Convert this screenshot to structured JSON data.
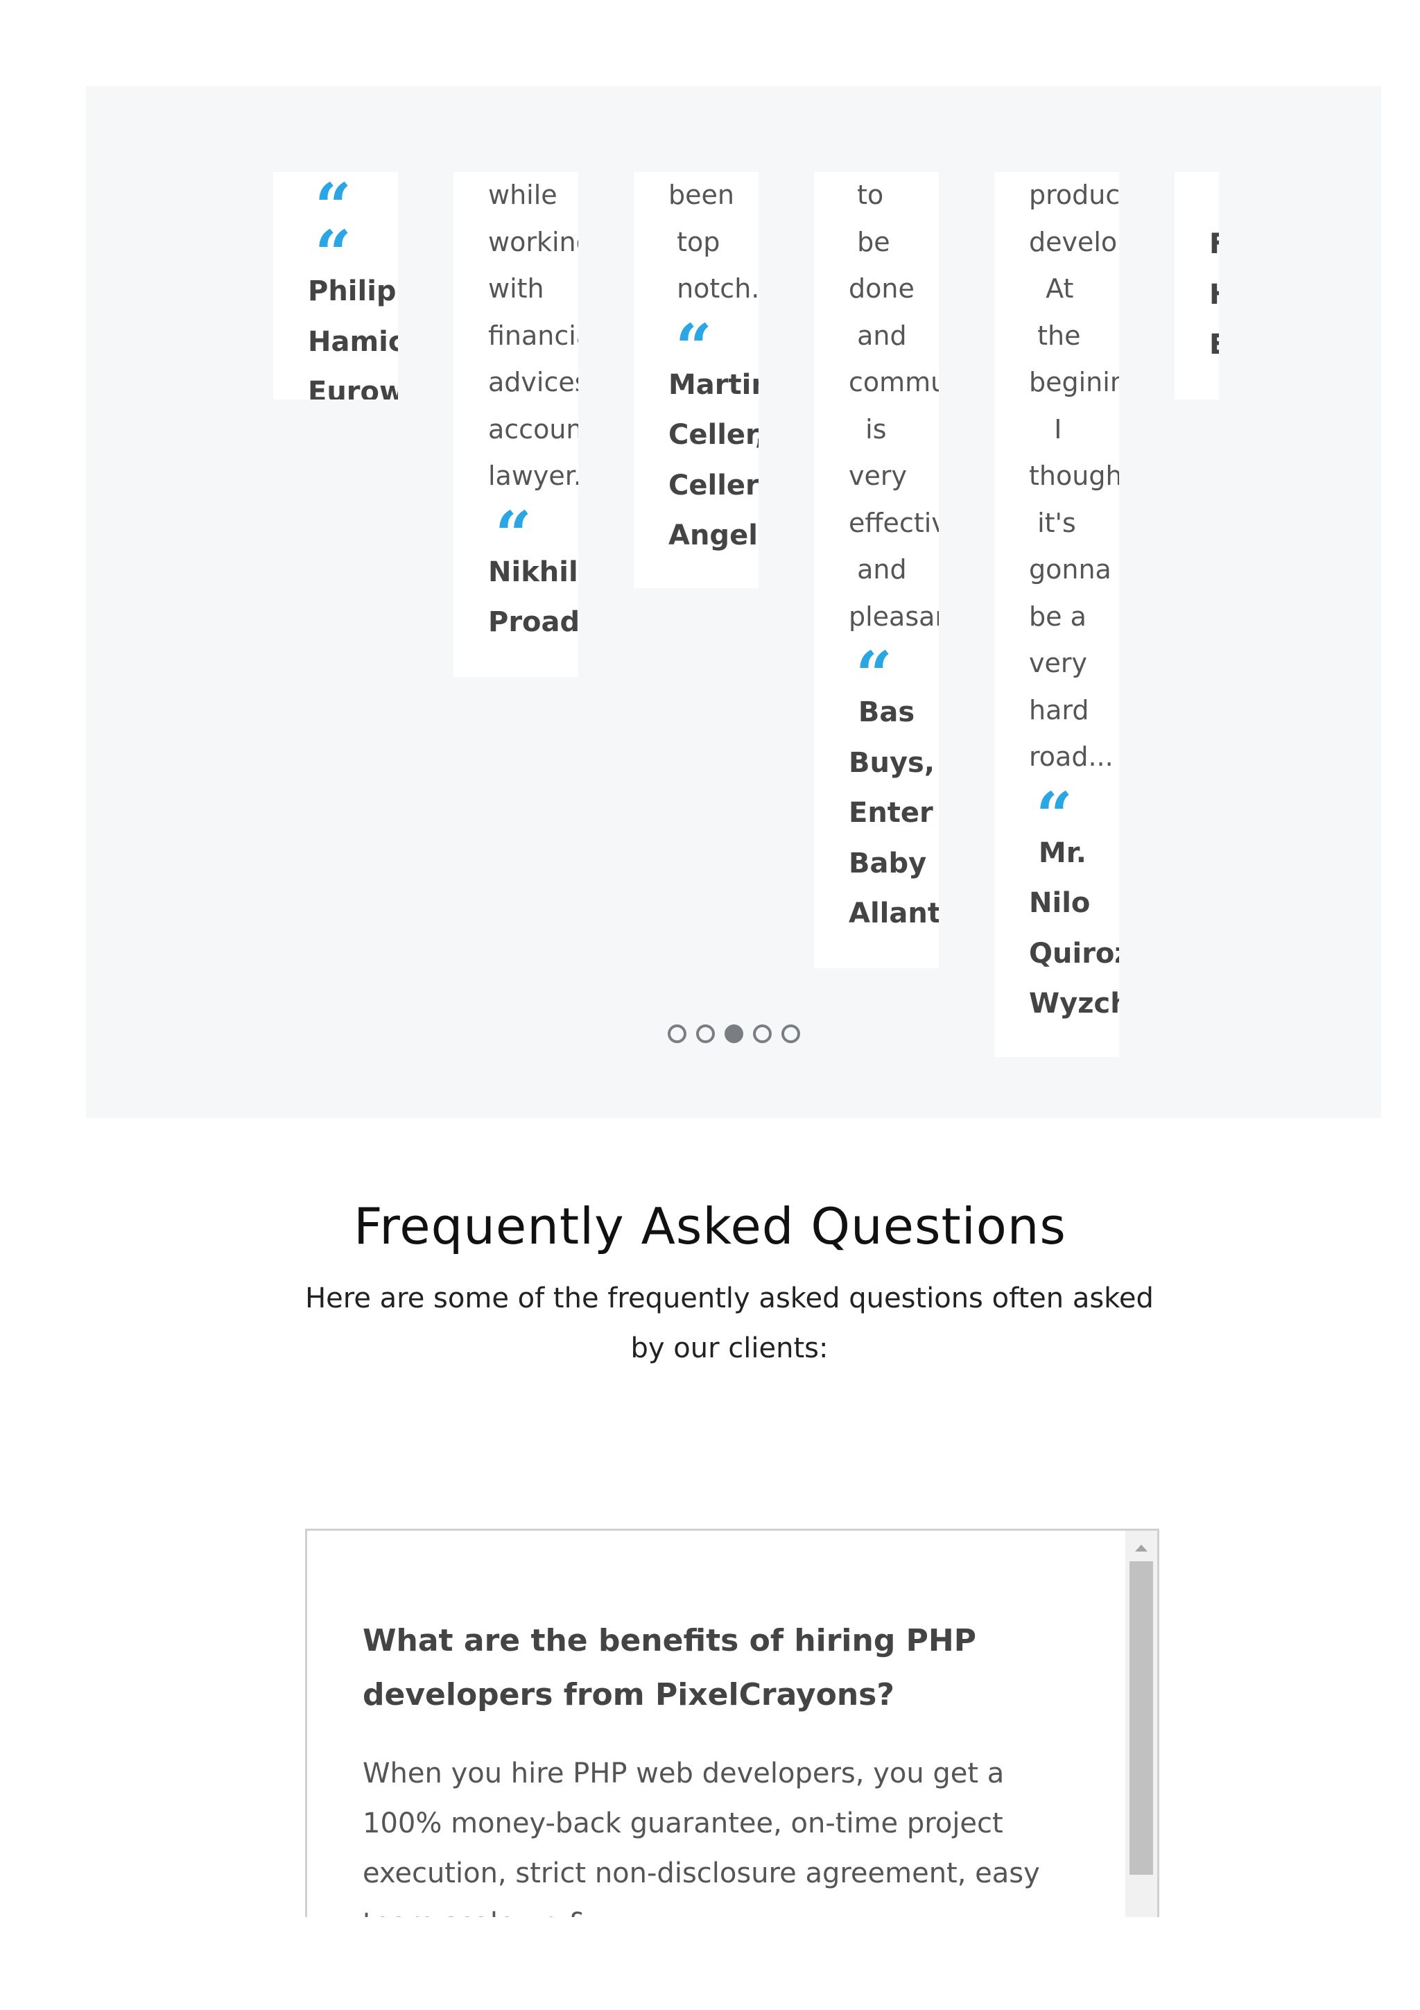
{
  "testimonials": [
    {
      "lines": [],
      "author": [
        "Philip",
        "Hamich",
        "Eurowi"
      ]
    },
    {
      "lines": [
        "while",
        "working",
        "with",
        "financia",
        "advices",
        "accoun",
        "lawyer."
      ],
      "author": [
        "Nikhil,",
        "Proadv"
      ]
    },
    {
      "lines": [
        "been",
        " top",
        " notch..."
      ],
      "author": [
        "Martin",
        "Celler,",
        "Celler",
        "Angels"
      ]
    },
    {
      "lines": [
        " to",
        " be",
        "done",
        " and",
        "commu",
        "  is",
        "very",
        "effectiv",
        " and",
        "pleasar"
      ],
      "author": [
        " Bas",
        "Buys,",
        "Enter",
        "Baby",
        "Allant"
      ]
    },
    {
      "lines": [
        "produc",
        "develop",
        "  At",
        " the",
        "beginin",
        "   I",
        "though",
        " it's",
        "gonna",
        "be a",
        "very",
        "hard",
        "road..."
      ],
      "author": [
        " Mr.",
        "Nilo",
        "Quiroz,",
        "Wyzche"
      ]
    },
    {
      "lines": [],
      "author": [
        "F",
        "H",
        "E"
      ]
    }
  ],
  "quote_icon": "“",
  "quote_icon_name": "quote-icon",
  "carousel": {
    "dot_count": 5,
    "active_index": 2
  },
  "faq": {
    "title": "Frequently Asked Questions",
    "subtitle": "Here are some of the frequently asked questions often asked by our clients:",
    "items": [
      {
        "question": "What are the benefits of hiring PHP developers from PixelCrayons?",
        "answer": "When you hire PHP web developers, you get a 100% money-back guarantee, on-time project execution, strict non-disclosure agreement, easy team scale up &"
      }
    ]
  },
  "colors": {
    "accent": "#29a6e3",
    "section_bg": "#f6f7f9",
    "dot": "#7a7d82"
  }
}
